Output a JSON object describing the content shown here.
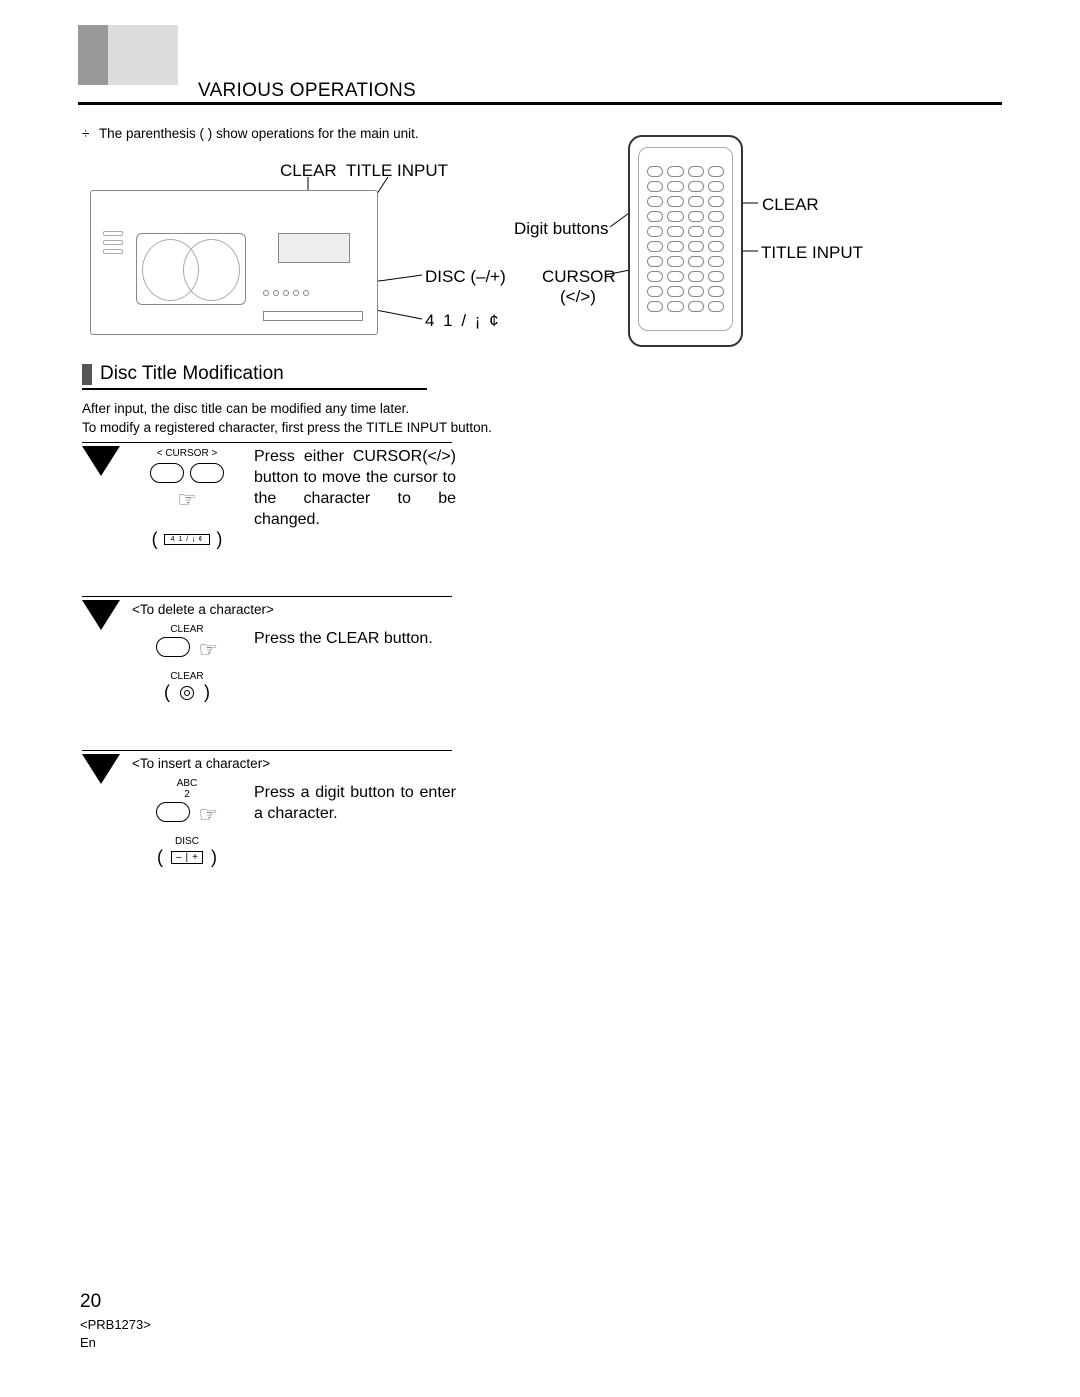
{
  "header": {
    "title": "VARIOUS OPERATIONS"
  },
  "note": {
    "bullet": "÷",
    "text": "The parenthesis (   ) show operations for the main unit."
  },
  "diagram_labels": {
    "clear": "CLEAR",
    "title_input": "TITLE INPUT",
    "disc": "DISC (–/+)",
    "numbers": "4   1   / ¡    ¢",
    "digit_buttons": "Digit buttons",
    "cursor": "CURSOR",
    "cursor_sym": "(</>)",
    "remote_clear": "CLEAR",
    "remote_title": "TITLE INPUT"
  },
  "section": {
    "title": "Disc Title Modification",
    "intro_line1": "After input, the disc title can be modified any time later.",
    "intro_line2": "To modify a registered character, first press the TITLE INPUT button."
  },
  "step1": {
    "cursor_label_left": "<",
    "cursor_label_mid": "CURSOR",
    "cursor_label_right": ">",
    "body": "Press either CURSOR(</>) button to move the cursor to the character to be changed.",
    "panel_text": "4   1   / ¡    ¢",
    "paren_open": "(",
    "paren_close": ")"
  },
  "step2": {
    "heading": "<To delete a character>",
    "btn_label": "CLEAR",
    "btn_label2": "CLEAR",
    "body": "Press the CLEAR button.",
    "paren_open": "(",
    "paren_close": ")"
  },
  "step3": {
    "heading": "<To insert a character>",
    "btn_label_top": "ABC",
    "btn_label_num": "2",
    "btn_label_bottom": "DISC",
    "body": "Press a digit button to enter a character.",
    "paren_open": "(",
    "paren_close": ")"
  },
  "footer": {
    "page": "20",
    "code": "<PRB1273>",
    "lang": "En"
  }
}
